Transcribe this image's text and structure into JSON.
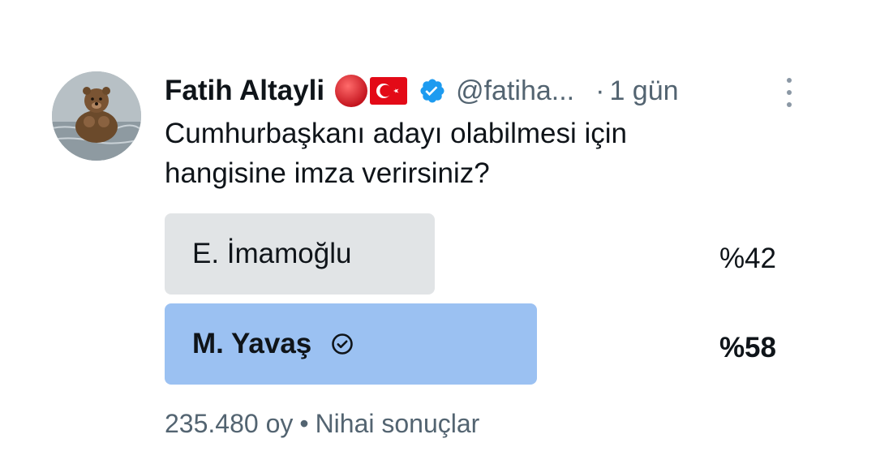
{
  "tweet": {
    "author_name": "Fatih Altayli",
    "handle": "@fatiha...",
    "dot": "·",
    "time": "1 gün",
    "question_line1": "Cumhurbaşkanı adayı olabilmesi için",
    "question_line2": "hangisine imza verirsiniz?"
  },
  "poll": {
    "options": [
      {
        "label": "E. İmamoğlu",
        "percent": "%42",
        "share": 0.42,
        "winner": false
      },
      {
        "label": "M. Yavaş",
        "percent": "%58",
        "share": 0.58,
        "winner": true
      }
    ],
    "votes": "235.480 oy",
    "separator": "•",
    "status": "Nihai sonuçlar"
  },
  "colors": {
    "text": "#0f1419",
    "muted": "#536471",
    "verified": "#1d9bf0",
    "bar_loser": "#e1e4e6",
    "bar_winner": "#9bc1f2"
  },
  "icons": [
    "avatar-bear-photo",
    "red-circle-emoji",
    "turkish-flag-emoji",
    "verified-badge-icon",
    "more-options-icon",
    "check-circle-icon"
  ]
}
